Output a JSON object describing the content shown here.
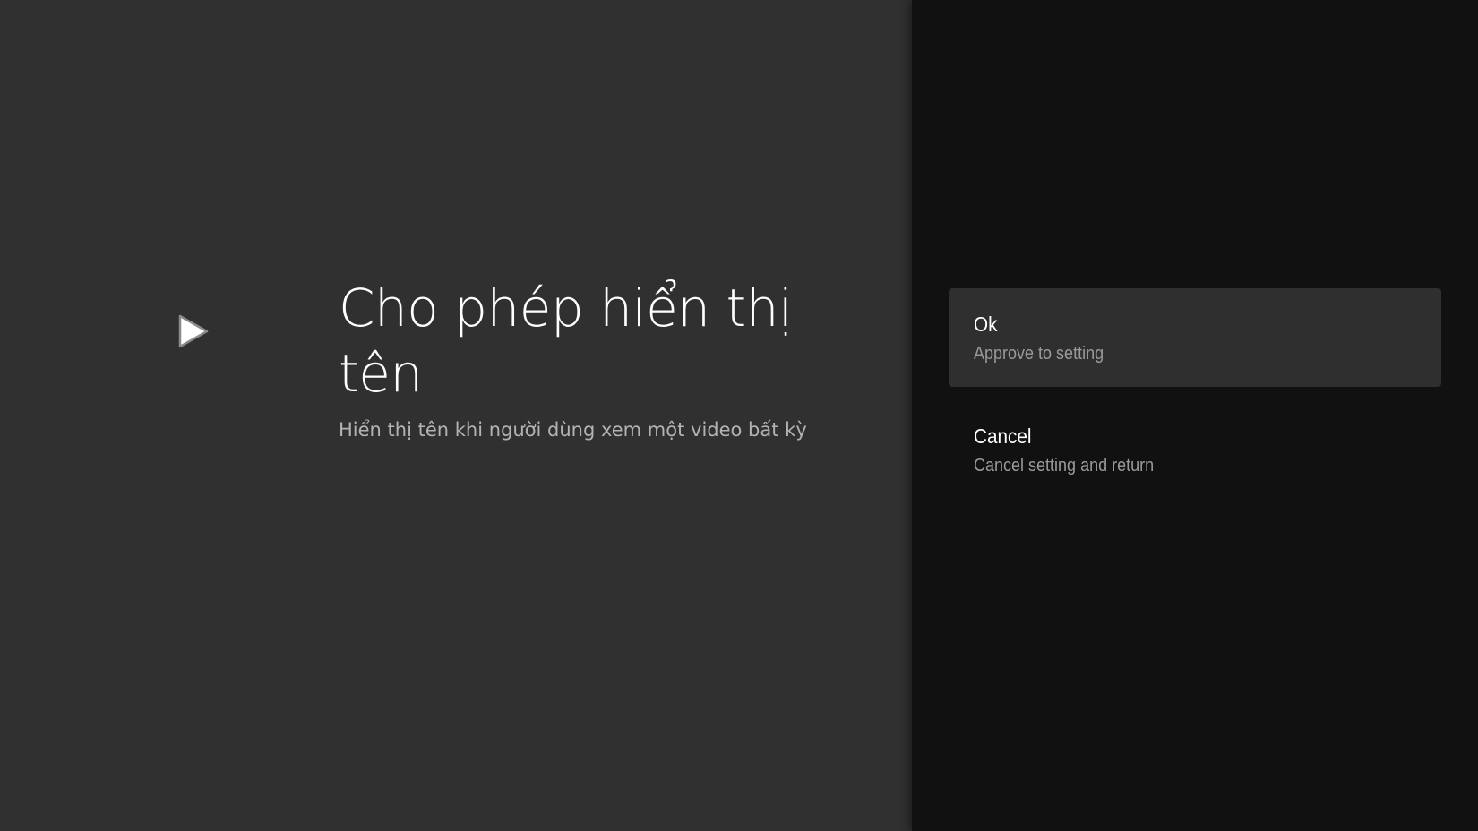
{
  "guidance": {
    "icon": "play-arrow-icon",
    "title": "Cho phép hiển thị tên",
    "description": "Hiển thị tên khi người dùng xem một video bất kỳ"
  },
  "actions": [
    {
      "title": "Ok",
      "description": "Approve to setting",
      "focused": true
    },
    {
      "title": "Cancel",
      "description": "Cancel setting and return",
      "focused": false
    }
  ],
  "colors": {
    "guidance_background": "#303030",
    "actions_background": "#111111",
    "focused_action_background": "#2f2f2f",
    "title_text": "#ffffff",
    "secondary_text": "#9a9a9a"
  }
}
